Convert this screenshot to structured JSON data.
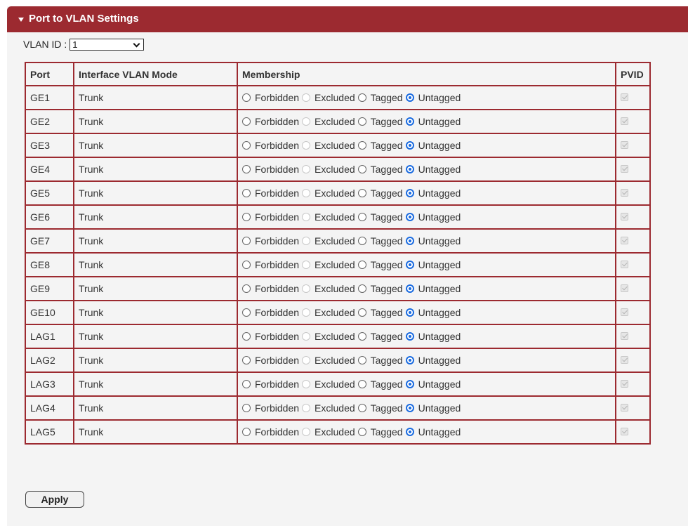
{
  "panel": {
    "title": "Port to VLAN Settings"
  },
  "vlan_id": {
    "label": "VLAN ID :",
    "selected": "1"
  },
  "table": {
    "headers": {
      "port": "Port",
      "mode": "Interface VLAN Mode",
      "membership": "Membership",
      "pvid": "PVID"
    },
    "options": [
      "Forbidden",
      "Excluded",
      "Tagged",
      "Untagged"
    ],
    "rows": [
      {
        "port": "GE1",
        "mode": "Trunk",
        "membership": "Untagged",
        "pvid": true
      },
      {
        "port": "GE2",
        "mode": "Trunk",
        "membership": "Untagged",
        "pvid": true
      },
      {
        "port": "GE3",
        "mode": "Trunk",
        "membership": "Untagged",
        "pvid": true
      },
      {
        "port": "GE4",
        "mode": "Trunk",
        "membership": "Untagged",
        "pvid": true
      },
      {
        "port": "GE5",
        "mode": "Trunk",
        "membership": "Untagged",
        "pvid": true
      },
      {
        "port": "GE6",
        "mode": "Trunk",
        "membership": "Untagged",
        "pvid": true
      },
      {
        "port": "GE7",
        "mode": "Trunk",
        "membership": "Untagged",
        "pvid": true
      },
      {
        "port": "GE8",
        "mode": "Trunk",
        "membership": "Untagged",
        "pvid": true
      },
      {
        "port": "GE9",
        "mode": "Trunk",
        "membership": "Untagged",
        "pvid": true
      },
      {
        "port": "GE10",
        "mode": "Trunk",
        "membership": "Untagged",
        "pvid": true
      },
      {
        "port": "LAG1",
        "mode": "Trunk",
        "membership": "Untagged",
        "pvid": true
      },
      {
        "port": "LAG2",
        "mode": "Trunk",
        "membership": "Untagged",
        "pvid": true
      },
      {
        "port": "LAG3",
        "mode": "Trunk",
        "membership": "Untagged",
        "pvid": true
      },
      {
        "port": "LAG4",
        "mode": "Trunk",
        "membership": "Untagged",
        "pvid": true
      },
      {
        "port": "LAG5",
        "mode": "Trunk",
        "membership": "Untagged",
        "pvid": true
      }
    ]
  },
  "apply_label": "Apply",
  "colors": {
    "header_bg": "#9c2a30",
    "border": "#9c2a30",
    "radio_checked": "#1a6be0",
    "panel_bg": "#f4f4f4"
  }
}
